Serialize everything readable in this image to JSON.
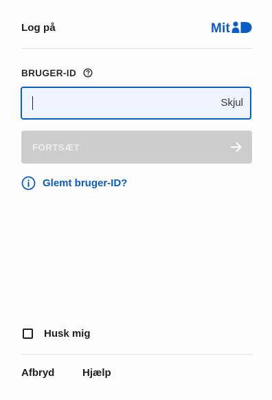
{
  "header": {
    "title": "Log på",
    "logo_text": "Mit",
    "logo_mark_icon": "mitid-person-badge",
    "brand_color": "#0a5cc7"
  },
  "login_form": {
    "field_label": "BRUGER-ID",
    "help_icon": "question-circle-icon",
    "user_id_value": "",
    "toggle_label": "Skjul",
    "continue_label": "FORTSÆT",
    "continue_icon": "arrow-right-icon",
    "continue_disabled": true,
    "forgot_label": "Glemt bruger-ID?",
    "forgot_icon": "info-circle-icon"
  },
  "remember": {
    "label": "Husk mig",
    "checked": false
  },
  "footer": {
    "cancel_label": "Afbryd",
    "help_label": "Hjælp"
  }
}
